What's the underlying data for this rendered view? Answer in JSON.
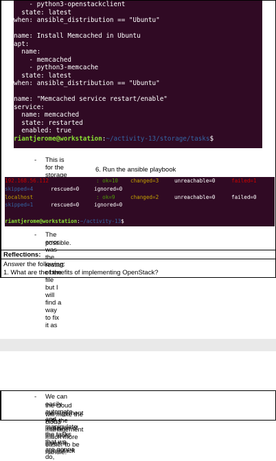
{
  "terminal1": {
    "lines": [
      [
        {
          "t": "    - python3-openstackclient",
          "c": "c-white"
        }
      ],
      [
        {
          "t": "  state: latest",
          "c": "c-white"
        }
      ],
      [
        {
          "t": "when: ansible_distribution == \"Ubuntu\"",
          "c": "c-white"
        }
      ],
      [
        {
          "t": "",
          "c": "c-white"
        }
      ],
      [
        {
          "t": "name: Install Memcached in Ubuntu",
          "c": "c-white"
        }
      ],
      [
        {
          "t": "apt:",
          "c": "c-white"
        }
      ],
      [
        {
          "t": "  name:",
          "c": "c-white"
        }
      ],
      [
        {
          "t": "    - memcached",
          "c": "c-white"
        }
      ],
      [
        {
          "t": "    - python3-memcache",
          "c": "c-white"
        }
      ],
      [
        {
          "t": "  state: latest",
          "c": "c-white"
        }
      ],
      [
        {
          "t": "when: ansible_distribution == \"Ubuntu\"",
          "c": "c-white"
        }
      ],
      [
        {
          "t": "",
          "c": "c-white"
        }
      ],
      [
        {
          "t": "name: \"Memcached service restart/enable\"",
          "c": "c-white"
        }
      ],
      [
        {
          "t": "service:",
          "c": "c-white"
        }
      ],
      [
        {
          "t": "  name: memcached",
          "c": "c-white"
        }
      ],
      [
        {
          "t": "  state: restarted",
          "c": "c-white"
        }
      ],
      [
        {
          "t": "  enabled: true",
          "c": "c-white"
        }
      ],
      [
        {
          "t": "riantjerome@workstation",
          "c": "c-green-bold"
        },
        {
          "t": ":",
          "c": "c-white"
        },
        {
          "t": "~/activity-13/storage/tasks",
          "c": "c-blue"
        },
        {
          "t": "$",
          "c": "c-white"
        }
      ]
    ]
  },
  "caption1": "This is for the storage role",
  "step_heading": "6. Run the ansible playbook",
  "terminal2": {
    "rows": [
      [
        {
          "t": "192.168.56.112",
          "c": "c-red"
        },
        {
          "t": ": ok=10",
          "c": "c-green"
        },
        {
          "t": "changed=3",
          "c": "c-yellow"
        },
        {
          "t": "unreachable=0",
          "c": "c-white"
        },
        {
          "t": "failed=1",
          "c": "c-red"
        }
      ],
      [
        {
          "t": "skipped=4",
          "c": "c-blue"
        },
        {
          "t": "rescued=0",
          "c": "c-white"
        },
        {
          "t": "ignored=0",
          "c": "c-white"
        }
      ],
      [
        {
          "t": "localhost",
          "c": "c-yellow"
        },
        {
          "t": ": ok=9",
          "c": "c-green"
        },
        {
          "t": "changed=2",
          "c": "c-yellow"
        },
        {
          "t": "unreachable=0",
          "c": "c-white"
        },
        {
          "t": "failed=0",
          "c": "c-white"
        }
      ],
      [
        {
          "t": "skipped=1",
          "c": "c-blue"
        },
        {
          "t": "rescued=0",
          "c": "c-white"
        },
        {
          "t": "ignored=0",
          "c": "c-white"
        }
      ],
      [],
      [
        {
          "t": "riantjerome@workstation",
          "c": "c-green-bold"
        },
        {
          "t": ":",
          "c": "c-white"
        },
        {
          "t": "~/activity-13",
          "c": "c-blue"
        },
        {
          "t": "$",
          "c": "c-white"
        }
      ]
    ]
  },
  "error_note_line1": "The error was the restart of the file but I will find a way to fix it as",
  "error_note_line2": "possible.",
  "reflections_heading": "Reflections:",
  "answer_prompt": "Answer the following:",
  "question1": "1.  What are the benefits of implementing OpenStack?",
  "answer_line1": "We can easily automate and manipulate the tasks that we are gonna do,",
  "answer_line2": "the cloud management with the inclusion of the tools given in openstack",
  "answer_line3": "will make the cloud management much more easier to be handle."
}
